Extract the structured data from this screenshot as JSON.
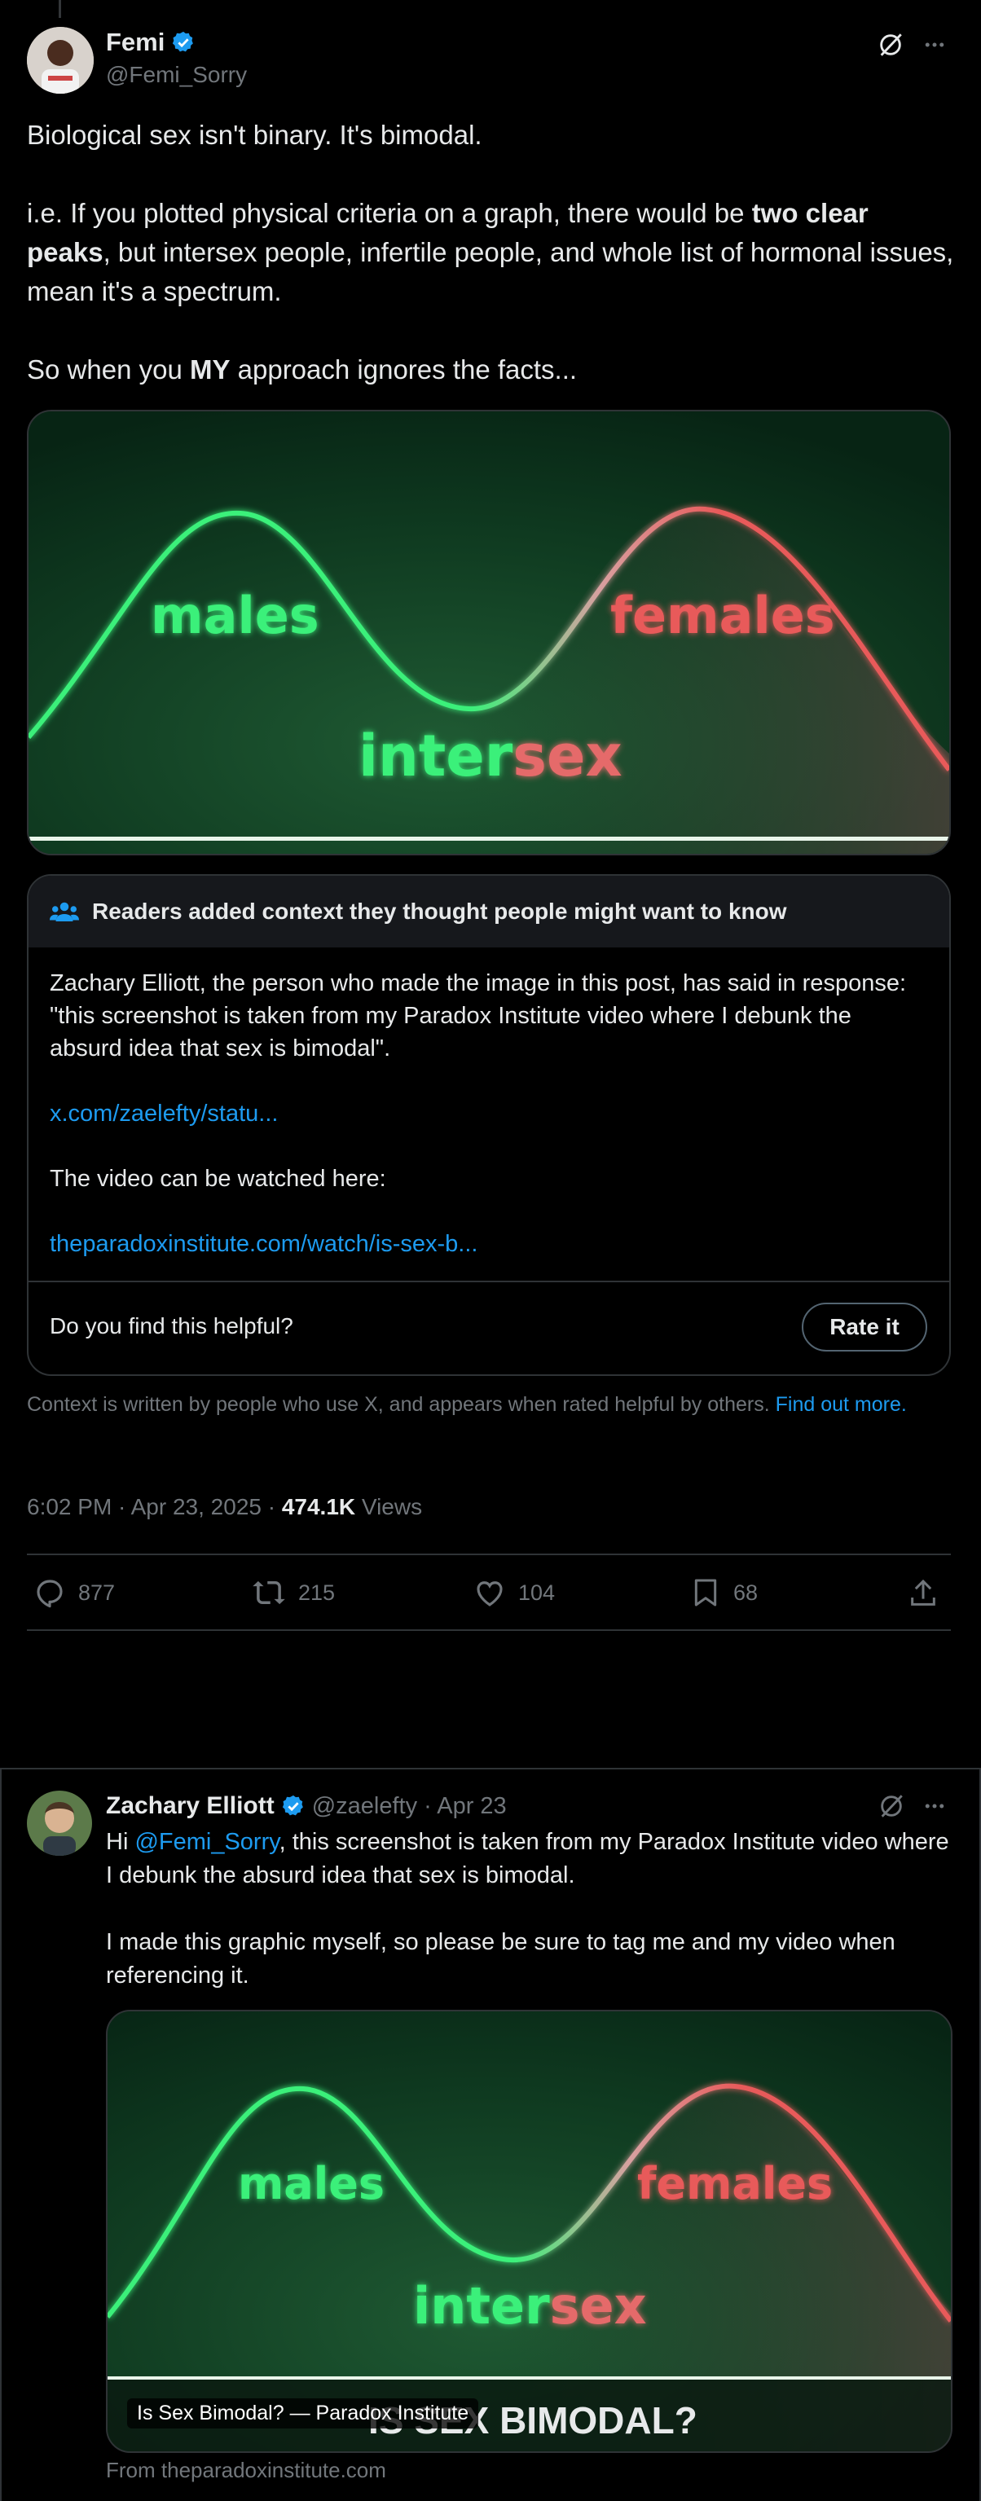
{
  "tweet": {
    "author_name": "Femi",
    "author_handle": "@Femi_Sorry",
    "text_line1": "Biological sex isn't binary. It's bimodal.",
    "text_p2_pre": "i.e. If you plotted physical criteria on a graph, there would be ",
    "text_p2_bold": "two clear peaks",
    "text_p2_post": ", but intersex people, infertile people, and whole list of hormonal issues, mean it's a spectrum.",
    "text_p3_pre": "So when you ",
    "text_p3_bold": "MY",
    "text_p3_post": " approach ignores the facts...",
    "image_labels": {
      "males": "males",
      "females": "females",
      "intersex_a": "inter",
      "intersex_b": "sex"
    },
    "timestamp": "6:02 PM · Apr 23, 2025 · ",
    "views_count": "474.1K",
    "views_label": " Views",
    "actions": {
      "replies": "877",
      "retweets": "215",
      "likes": "104",
      "bookmarks": "68"
    }
  },
  "community_note": {
    "header": "Readers added context they thought people might want to know",
    "body": "Zachary Elliott, the person who made the image in this post, has said in response: \"this screenshot is taken from my Paradox Institute video where I debunk the absurd idea that sex is bimodal\".",
    "link1": "x.com/zaelefty/statu...",
    "video_text": "The video can be watched here:",
    "link2": "theparadoxinstitute.com/watch/is-sex-b...",
    "helpful_question": "Do you find this helpful?",
    "rate_button": "Rate it",
    "footer_text": "Context is written by people who use X, and appears when rated helpful by others.",
    "footer_link": "Find out more."
  },
  "reply": {
    "author_name": "Zachary Elliott",
    "author_handle": "@zaelefty",
    "date": " · Apr 23",
    "text_pre": "Hi ",
    "mention": "@Femi_Sorry",
    "text_post": ", this screenshot is taken from my Paradox Institute video where I debunk the absurd idea that sex is bimodal.",
    "text_p2": "I made this graphic myself, so please be sure to tag me and my video when referencing it.",
    "card_title": "Is Sex Bimodal? — Paradox Institute",
    "card_overlay": "IS SEX BIMODAL?",
    "card_source": "From theparadoxinstitute.com"
  },
  "colors": {
    "accent": "#1d9bf0",
    "green": "#3bf07a",
    "red": "#e85a5a",
    "bg": "#000000"
  }
}
